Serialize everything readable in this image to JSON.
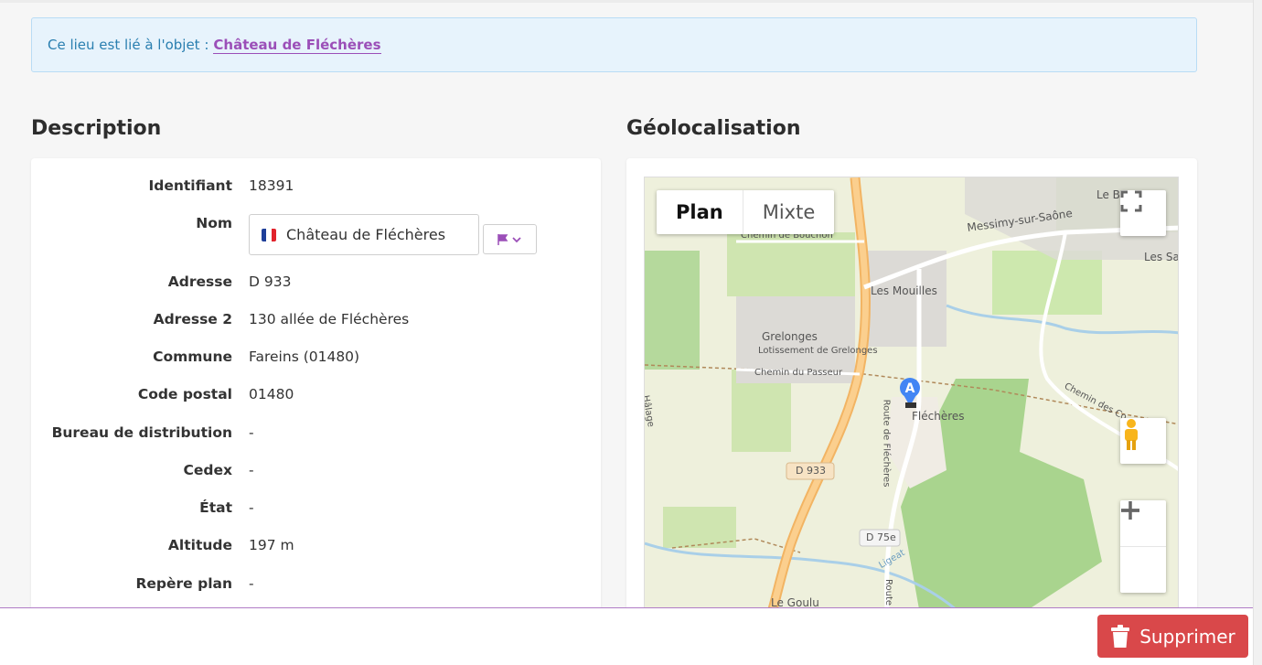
{
  "alert": {
    "prefix": "Ce lieu est lié à l'objet :",
    "link": "Château de Fléchères"
  },
  "description": {
    "title": "Description",
    "fields": [
      {
        "label": "Identifiant",
        "value": "18391"
      },
      {
        "label": "Nom",
        "value": "Château de Fléchères"
      },
      {
        "label": "Adresse",
        "value": "D 933"
      },
      {
        "label": "Adresse 2",
        "value": "130 allée de Fléchères"
      },
      {
        "label": "Commune",
        "value": "Fareins (01480)"
      },
      {
        "label": "Code postal",
        "value": "01480"
      },
      {
        "label": "Bureau de distribution",
        "value": "-"
      },
      {
        "label": "Cedex",
        "value": "-"
      },
      {
        "label": "État",
        "value": "-"
      },
      {
        "label": "Altitude",
        "value": "197 m"
      },
      {
        "label": "Repère plan",
        "value": "-"
      }
    ]
  },
  "geo": {
    "title": "Géolocalisation",
    "map_types": [
      "Plan",
      "Mixte"
    ],
    "active_map_type": "Plan",
    "marker_label": "A",
    "place_labels": [
      "Le B",
      "Messimy-sur-Saône",
      "Les Sa",
      "Chemin de Bouchon",
      "Les Mouilles",
      "Grelonges",
      "Lotissement de Grelonges",
      "Chemin du Passeur",
      "Fléchères",
      "Chemin des Co",
      "Route de Fléchères",
      "D 933",
      "D 75e",
      "Le Goulu",
      "Route",
      "Ligeat",
      "Hâlage"
    ],
    "icons": {
      "fullscreen": "fullscreen-icon",
      "pegman": "pegman-icon",
      "zoom_in": "zoom-in-icon",
      "zoom_out": "zoom-out-icon"
    }
  },
  "actions": {
    "delete_label": "Supprimer"
  },
  "colors": {
    "accent": "#9b4fb8",
    "alert_bg": "#e7f3fc",
    "alert_text": "#2a7fb0",
    "delete": "#d9484a"
  }
}
